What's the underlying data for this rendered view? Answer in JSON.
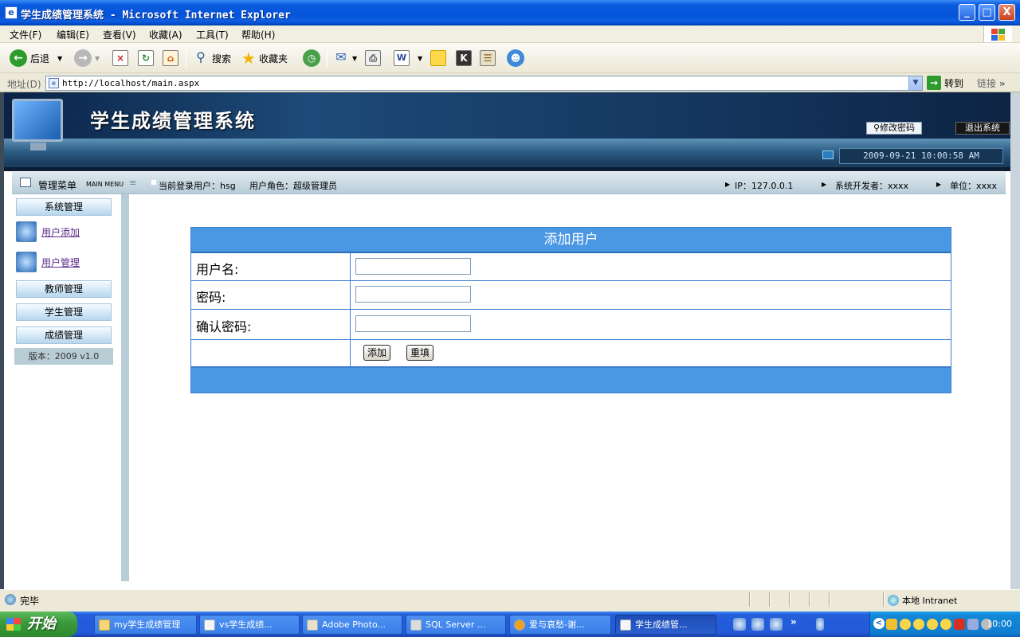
{
  "window": {
    "title": "学生成绩管理系统 - Microsoft Internet Explorer",
    "minimize": "_",
    "maximize": "□",
    "close": "X"
  },
  "menu": [
    "文件(F)",
    "编辑(E)",
    "查看(V)",
    "收藏(A)",
    "工具(T)",
    "帮助(H)"
  ],
  "toolbar": {
    "back": "后退",
    "search": "搜索",
    "favorites": "收藏夹"
  },
  "address": {
    "label": "地址(D)",
    "url": "http://localhost/main.aspx",
    "go": "转到",
    "links": "链接"
  },
  "banner": {
    "title": "学生成绩管理系统",
    "change_password": "修改密码",
    "logout": "退出系统",
    "datetime": "2009-09-21 10:00:58 AM"
  },
  "infobar": {
    "menu_title": "管理菜单",
    "menu_sub": "MAIN MENU",
    "current_user": "当前登录用户：hsg",
    "role": "用户角色：超级管理员",
    "ip": "IP：127.0.0.1",
    "developer": "系统开发者：xxxx",
    "unit": "单位：xxxx"
  },
  "sidebar": {
    "system": "系统管理",
    "add_user": "用户添加",
    "manage_user": "用户管理",
    "teacher": "教师管理",
    "student": "学生管理",
    "score": "成绩管理",
    "version": "版本：2009 v1.0"
  },
  "form": {
    "title": "添加用户",
    "username_label": "用户名:",
    "password_label": "密码:",
    "confirm_label": "确认密码:",
    "username_value": "",
    "password_value": "",
    "confirm_value": "",
    "add_button": "添加",
    "reset_button": "重填"
  },
  "status": {
    "text": "完毕",
    "zone": "本地 Intranet"
  },
  "taskbar": {
    "start": "开始",
    "tasks": [
      "my学生成绩管理",
      "vs学生成绩...",
      "Adobe Photo...",
      "SQL Server ...",
      "爱与哀愁-谢...",
      "学生成绩管..."
    ],
    "clock": "10:00"
  }
}
